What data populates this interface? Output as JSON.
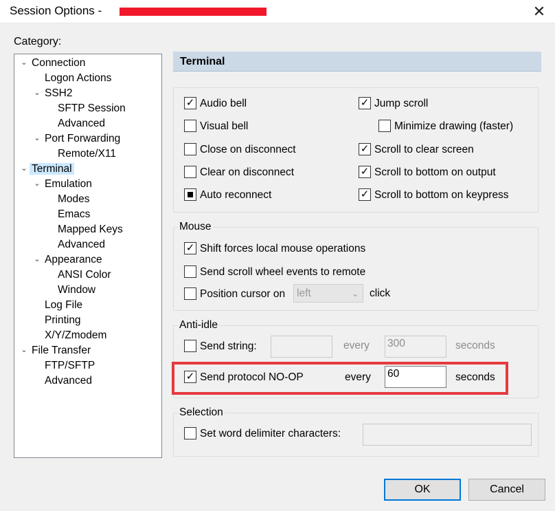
{
  "window": {
    "title": "Session Options - ",
    "close_glyph": "✕"
  },
  "category_label": "Category:",
  "tree": [
    {
      "label": "Connection",
      "toggle": "⌄",
      "selected": false
    },
    {
      "label": "Logon Actions",
      "toggle": "",
      "selected": false
    },
    {
      "label": "SSH2",
      "toggle": "⌄",
      "selected": false
    },
    {
      "label": "SFTP Session",
      "toggle": "",
      "selected": false
    },
    {
      "label": "Advanced",
      "toggle": "",
      "selected": false
    },
    {
      "label": "Port Forwarding",
      "toggle": "⌄",
      "selected": false
    },
    {
      "label": "Remote/X11",
      "toggle": "",
      "selected": false
    },
    {
      "label": "Terminal",
      "toggle": "⌄",
      "selected": true
    },
    {
      "label": "Emulation",
      "toggle": "⌄",
      "selected": false
    },
    {
      "label": "Modes",
      "toggle": "",
      "selected": false
    },
    {
      "label": "Emacs",
      "toggle": "",
      "selected": false
    },
    {
      "label": "Mapped Keys",
      "toggle": "",
      "selected": false
    },
    {
      "label": "Advanced",
      "toggle": "",
      "selected": false
    },
    {
      "label": "Appearance",
      "toggle": "⌄",
      "selected": false
    },
    {
      "label": "ANSI Color",
      "toggle": "",
      "selected": false
    },
    {
      "label": "Window",
      "toggle": "",
      "selected": false
    },
    {
      "label": "Log File",
      "toggle": "",
      "selected": false
    },
    {
      "label": "Printing",
      "toggle": "",
      "selected": false
    },
    {
      "label": "X/Y/Zmodem",
      "toggle": "",
      "selected": false
    },
    {
      "label": "File Transfer",
      "toggle": "⌄",
      "selected": false
    },
    {
      "label": "FTP/SFTP",
      "toggle": "",
      "selected": false
    },
    {
      "label": "Advanced",
      "toggle": "",
      "selected": false
    }
  ],
  "panel_title": "Terminal",
  "terminal_options": [
    {
      "label": "Audio bell",
      "state": "checked"
    },
    {
      "label": "Jump scroll",
      "state": "checked"
    },
    {
      "label": "Visual bell",
      "state": "unchecked"
    },
    {
      "label": "Minimize drawing (faster)",
      "state": "unchecked"
    },
    {
      "label": "Close on disconnect",
      "state": "unchecked"
    },
    {
      "label": "Scroll to clear screen",
      "state": "checked"
    },
    {
      "label": "Clear on disconnect",
      "state": "unchecked"
    },
    {
      "label": "Scroll to bottom on output",
      "state": "checked"
    },
    {
      "label": "Auto reconnect",
      "state": "indeterminate"
    },
    {
      "label": "Scroll to bottom on keypress",
      "state": "checked"
    }
  ],
  "mouse": {
    "title": "Mouse",
    "shift_forces": {
      "label": "Shift forces local mouse operations",
      "state": "checked"
    },
    "send_scroll": {
      "label": "Send scroll wheel events to remote",
      "state": "unchecked"
    },
    "position_cursor": {
      "label": "Position cursor on",
      "state": "unchecked"
    },
    "position_select_value": "left",
    "click_label": "click"
  },
  "anti_idle": {
    "title": "Anti-idle",
    "send_string": {
      "label": "Send string:",
      "state": "unchecked"
    },
    "send_string_value": "",
    "every_label_1": "every",
    "interval_1": "300",
    "seconds_label_1": "seconds",
    "send_noop": {
      "label": "Send protocol NO-OP",
      "state": "checked"
    },
    "every_label_2": "every",
    "interval_2": "60",
    "seconds_label_2": "seconds"
  },
  "selection": {
    "title": "Selection",
    "word_delim": {
      "label": "Set word delimiter characters:",
      "state": "unchecked"
    },
    "word_delim_value": ""
  },
  "buttons": {
    "ok": "OK",
    "cancel": "Cancel"
  },
  "colors": {
    "header_bg": "#cbd9e7",
    "tree_selected": "#cce8ff",
    "highlight_red": "#e53a3f",
    "redaction_red": "#f0182a",
    "primary_border": "#0078d7"
  }
}
